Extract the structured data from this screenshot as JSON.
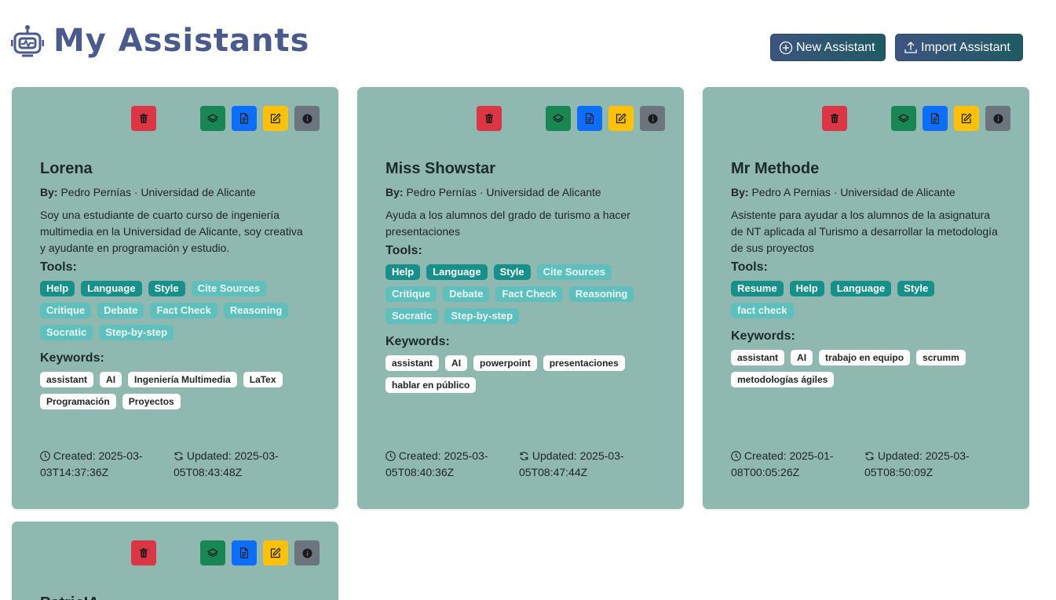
{
  "header": {
    "title": "My Assistants",
    "new_label": "New Assistant",
    "import_label": "Import Assistant"
  },
  "labels": {
    "by": "By:",
    "tools": "Tools:",
    "keywords": "Keywords:",
    "created": "Created:",
    "updated": "Updated:"
  },
  "colors": {
    "card_bg": "#8fb8b1",
    "tag_on": "#178f8b",
    "tag_off": "#5fbfbc",
    "delete": "#dc3545",
    "layers": "#198754",
    "doc": "#0d6efd",
    "edit": "#ffc107",
    "info": "#6c757d",
    "title": "#4a5a8c"
  },
  "icons": {
    "logo": "robot-icon",
    "new": "plus-circle-icon",
    "import": "upload-icon",
    "delete": "trash-icon",
    "layers": "layers-icon",
    "doc": "document-icon",
    "edit": "pencil-square-icon",
    "info": "info-circle-icon",
    "created": "clock-icon",
    "updated": "refresh-icon"
  },
  "cards": [
    {
      "name": "Lorena",
      "author": "Pedro Pernías · Universidad de Alicante",
      "description": "Soy una estudiante de cuarto curso de ingeniería multimedia en la Universidad de Alicante, soy creativa y ayudante en programación y estudio.",
      "tools": [
        {
          "label": "Help",
          "active": true
        },
        {
          "label": "Language",
          "active": true
        },
        {
          "label": "Style",
          "active": true
        },
        {
          "label": "Cite Sources",
          "active": false
        },
        {
          "label": "Critique",
          "active": false
        },
        {
          "label": "Debate",
          "active": false
        },
        {
          "label": "Fact Check",
          "active": false
        },
        {
          "label": "Reasoning",
          "active": false
        },
        {
          "label": "Socratic",
          "active": false
        },
        {
          "label": "Step-by-step",
          "active": false
        }
      ],
      "keywords": [
        "assistant",
        "AI",
        "Ingeniería Multimedia",
        "LaTex",
        "Programación",
        "Proyectos"
      ],
      "created": "2025-03-03T14:37:36Z",
      "updated": "2025-03-05T08:43:48Z"
    },
    {
      "name": "Miss Showstar",
      "author": "Pedro Pernías · Universidad de Alicante",
      "description": "Ayuda a los alumnos del grado de turismo a hacer presentaciones",
      "tools": [
        {
          "label": "Help",
          "active": true
        },
        {
          "label": "Language",
          "active": true
        },
        {
          "label": "Style",
          "active": true
        },
        {
          "label": "Cite Sources",
          "active": false
        },
        {
          "label": "Critique",
          "active": false
        },
        {
          "label": "Debate",
          "active": false
        },
        {
          "label": "Fact Check",
          "active": false
        },
        {
          "label": "Reasoning",
          "active": false
        },
        {
          "label": "Socratic",
          "active": false
        },
        {
          "label": "Step-by-step",
          "active": false
        }
      ],
      "keywords": [
        "assistant",
        "AI",
        "powerpoint",
        "presentaciones",
        "hablar en público"
      ],
      "created": "2025-03-05T08:40:36Z",
      "updated": "2025-03-05T08:47:44Z"
    },
    {
      "name": "Mr Methode",
      "author": "Pedro A Pernias · Universidad de Alicante",
      "description": "Asistente para ayudar a los alumnos de la asignatura de NT aplicada al Turismo a desarrollar la metodología de sus proyectos",
      "tools": [
        {
          "label": "Resume",
          "active": true
        },
        {
          "label": "Help",
          "active": true
        },
        {
          "label": "Language",
          "active": true
        },
        {
          "label": "Style",
          "active": true
        },
        {
          "label": "fact check",
          "active": false
        }
      ],
      "keywords": [
        "assistant",
        "AI",
        "trabajo en equipo",
        "scrumm",
        "metodologías ágiles"
      ],
      "created": "2025-01-08T00:05:26Z",
      "updated": "2025-03-05T08:50:09Z"
    },
    {
      "name": "PatricIA",
      "author": "",
      "description": "",
      "tools": [],
      "keywords": [],
      "created": "",
      "updated": ""
    }
  ]
}
